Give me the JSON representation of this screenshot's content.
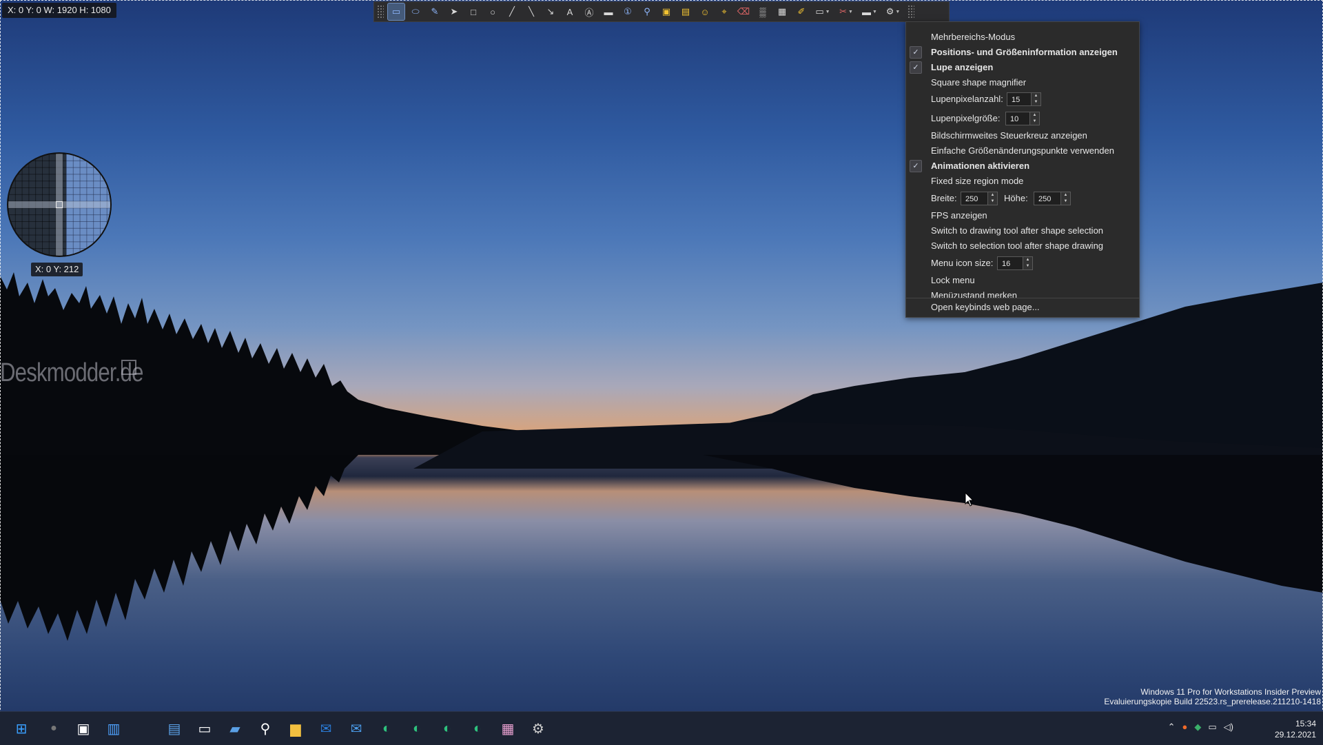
{
  "screen": {
    "position_info": "X: 0 Y: 0 W: 1920 H: 1080",
    "magnifier_coords": "X: 0 Y: 212",
    "watermark": "Deskmodder.de"
  },
  "toolbar": {
    "buttons": [
      {
        "icon": "region-select-icon",
        "active": true
      },
      {
        "icon": "ellipse-region-icon"
      },
      {
        "icon": "freehand-region-icon"
      },
      {
        "icon": "pointer-icon"
      },
      {
        "icon": "rectangle-icon"
      },
      {
        "icon": "ellipse-icon"
      },
      {
        "icon": "pen-icon"
      },
      {
        "icon": "line-icon"
      },
      {
        "icon": "arrow-icon"
      },
      {
        "icon": "text-outline-icon"
      },
      {
        "icon": "text-background-icon"
      },
      {
        "icon": "speech-balloon-icon"
      },
      {
        "icon": "step-number-icon"
      },
      {
        "icon": "magnify-icon"
      },
      {
        "icon": "image-file-icon"
      },
      {
        "icon": "image-screen-icon"
      },
      {
        "icon": "emoji-sticker-icon"
      },
      {
        "icon": "cursor-stamp-icon"
      },
      {
        "icon": "eraser-icon"
      },
      {
        "icon": "blur-icon"
      },
      {
        "icon": "pixelate-icon"
      },
      {
        "icon": "highlight-icon"
      },
      {
        "icon": "edit-dropdown-icon"
      },
      {
        "icon": "tools-dropdown-icon"
      },
      {
        "icon": "capture-dropdown-icon"
      },
      {
        "icon": "gear-icon"
      }
    ]
  },
  "menu": {
    "multi_region_mode": "Mehrbereichs-Modus",
    "show_position_info": "Positions- und Größeninformation anzeigen",
    "show_magnifier": "Lupe anzeigen",
    "square_magnifier": "Square shape magnifier",
    "magnifier_pixel_count_label": "Lupenpixelanzahl:",
    "magnifier_pixel_count": "15",
    "magnifier_pixel_size_label": "Lupenpixelgröße:",
    "magnifier_pixel_size": "10",
    "screen_crosshair": "Bildschirmweites Steuerkreuz anzeigen",
    "simple_resize_nodes": "Einfache Größenänderungspunkte verwenden",
    "enable_animations": "Animationen aktivieren",
    "fixed_size_region": "Fixed size region mode",
    "width_label": "Breite:",
    "width_value": "250",
    "height_label": "Höhe:",
    "height_value": "250",
    "show_fps": "FPS anzeigen",
    "switch_to_drawing": "Switch to drawing tool after shape selection",
    "switch_to_selection": "Switch to selection tool after shape drawing",
    "menu_icon_size_label": "Menu icon size:",
    "menu_icon_size": "16",
    "lock_menu": "Lock menu",
    "remember_menu_state": "Menüzustand merken",
    "open_keybinds": "Open keybinds web page..."
  },
  "system": {
    "edition": "Windows 11 Pro for Workstations Insider Preview",
    "build": "Evaluierungskopie Build 22523.rs_prerelease.211210-1418",
    "time": "15:34",
    "date": "29.12.2021"
  },
  "colors": {
    "menu_bg": "#2b2b2b",
    "toolbar_bg": "#2c2c2e",
    "taskbar_bg": "#1c2333",
    "accent": "#445a7a"
  }
}
